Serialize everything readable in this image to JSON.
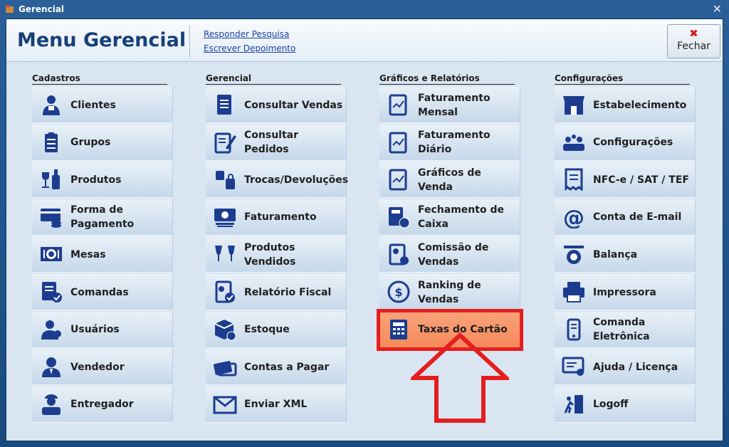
{
  "window": {
    "title": "Gerencial",
    "close_glyph": "✕"
  },
  "header": {
    "title": "Menu Gerencial",
    "links": [
      "Responder Pesquisa",
      "Escrever Depoimento"
    ],
    "close_button": {
      "glyph": "✖",
      "label": "Fechar",
      "icon": "close-icon"
    }
  },
  "columns": [
    {
      "title": "Cadastros",
      "items": [
        {
          "label": "Clientes",
          "icon": "client-icon"
        },
        {
          "label": "Grupos",
          "icon": "clipboard-list-icon"
        },
        {
          "label": "Produtos",
          "icon": "wine-bottle-icon"
        },
        {
          "label": "Forma de Pagamento",
          "icon": "payment-card-icon"
        },
        {
          "label": "Mesas",
          "icon": "table-plate-icon"
        },
        {
          "label": "Comandas",
          "icon": "order-check-icon"
        },
        {
          "label": "Usuários",
          "icon": "user-icon"
        },
        {
          "label": "Vendedor",
          "icon": "seller-icon"
        },
        {
          "label": "Entregador",
          "icon": "delivery-person-icon"
        }
      ]
    },
    {
      "title": "Gerencial",
      "items": [
        {
          "label": "Consultar Vendas",
          "icon": "document-icon"
        },
        {
          "label": "Consultar Pedidos",
          "icon": "edit-document-icon"
        },
        {
          "label": "Trocas/Devoluções",
          "icon": "shopping-bags-icon"
        },
        {
          "label": "Faturamento",
          "icon": "cash-icon"
        },
        {
          "label": "Produtos Vendidos",
          "icon": "wine-glasses-icon"
        },
        {
          "label": "Relatório Fiscal",
          "icon": "report-check-icon"
        },
        {
          "label": "Estoque",
          "icon": "stock-box-icon"
        },
        {
          "label": "Contas a Pagar",
          "icon": "credit-cards-icon"
        },
        {
          "label": "Enviar XML",
          "icon": "email-envelope-icon"
        }
      ]
    },
    {
      "title": "Gráficos e Relatórios",
      "items": [
        {
          "label": "Faturamento Mensal",
          "icon": "chart-document-icon"
        },
        {
          "label": "Faturamento Diário",
          "icon": "chart-document-icon"
        },
        {
          "label": "Gráficos de Venda",
          "icon": "chart-document-icon"
        },
        {
          "label": "Fechamento de Caixa",
          "icon": "calculator-money-icon"
        },
        {
          "label": "Comissão de Vendas",
          "icon": "commission-report-icon"
        },
        {
          "label": "Ranking de Vendas",
          "icon": "dollar-circle-icon"
        },
        {
          "label": "Taxas do Cartão",
          "icon": "calculator-icon",
          "highlighted": true
        }
      ]
    },
    {
      "title": "Configurações",
      "items": [
        {
          "label": "Estabelecimento",
          "icon": "store-icon"
        },
        {
          "label": "Configurações",
          "icon": "settings-people-icon"
        },
        {
          "label": "NFC-e / SAT / TEF",
          "icon": "receipt-icon"
        },
        {
          "label": "Conta de E-mail",
          "icon": "at-sign-icon"
        },
        {
          "label": "Balança",
          "icon": "scale-icon"
        },
        {
          "label": "Impressora",
          "icon": "printer-icon"
        },
        {
          "label": "Comanda Eletrônica",
          "icon": "mobile-device-icon"
        },
        {
          "label": "Ajuda / Licença",
          "icon": "license-certificate-icon"
        },
        {
          "label": "Logoff",
          "icon": "exit-door-icon"
        }
      ]
    }
  ],
  "colors": {
    "accent": "#17407a",
    "highlight": "#f5895a",
    "highlight_border": "#e41e1e",
    "arrow": "#e41e1e"
  }
}
